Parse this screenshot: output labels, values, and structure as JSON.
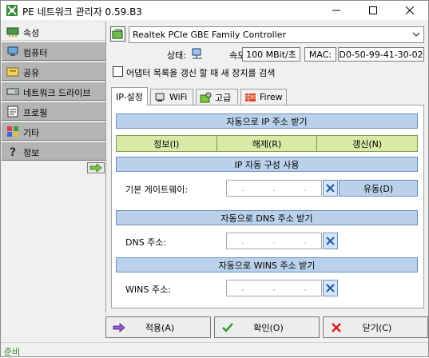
{
  "window": {
    "title": "PE 네트워크 관리자 0.59.B3"
  },
  "sidebar": {
    "items": [
      {
        "label": "속성",
        "icon": "network-card-icon"
      },
      {
        "label": "컴퓨터",
        "icon": "computer-icon"
      },
      {
        "label": "공유",
        "icon": "share-icon"
      },
      {
        "label": "네트워크 드라이브",
        "icon": "network-drive-icon"
      },
      {
        "label": "프로필",
        "icon": "profile-icon"
      },
      {
        "label": "기타",
        "icon": "misc-icon"
      },
      {
        "label": "정보",
        "icon": "info-icon"
      }
    ]
  },
  "adapter": {
    "selected": "Realtek PCIe GBE Family Controller",
    "status_label": "상태:",
    "speed_label": "속도:",
    "speed_value": "100 MBit/초",
    "mac_label": "MAC:",
    "mac_value": "D0-50-99-41-30-02",
    "refresh_checkbox_label": "어댑터 목록을 갱신 할 때 새 장치를 검색",
    "refresh_checked": false
  },
  "tabs": [
    {
      "label": "IP-설정"
    },
    {
      "label": "WiFi"
    },
    {
      "label": "고급"
    },
    {
      "label": "Firew"
    }
  ],
  "ip": {
    "auto_ip_bar": "자동으로 IP 주소 받기",
    "buttons": [
      "정보(I)",
      "해제(R)",
      "갱신(N)"
    ],
    "auto_config_bar": "IP 자동 구성 사용",
    "gateway_label": "기본 게이트웨이:",
    "gateway_value": "",
    "use_button": "유동(D)",
    "auto_dns_bar": "자동으로 DNS 주소 받기",
    "dns_label": "DNS 주소:",
    "dns_value": "",
    "auto_wins_bar": "자동으로 WINS 주소 받기",
    "wins_label": "WINS 주소:",
    "wins_value": "",
    "ip_separator": "."
  },
  "footer": {
    "apply": "적용(A)",
    "ok": "확인(O)",
    "close": "닫기(C)",
    "status": "준비"
  },
  "colors": {
    "section_bar": "#b9d1ea",
    "action_row": "#d8eaa6",
    "status_text": "#2e8b2e"
  }
}
